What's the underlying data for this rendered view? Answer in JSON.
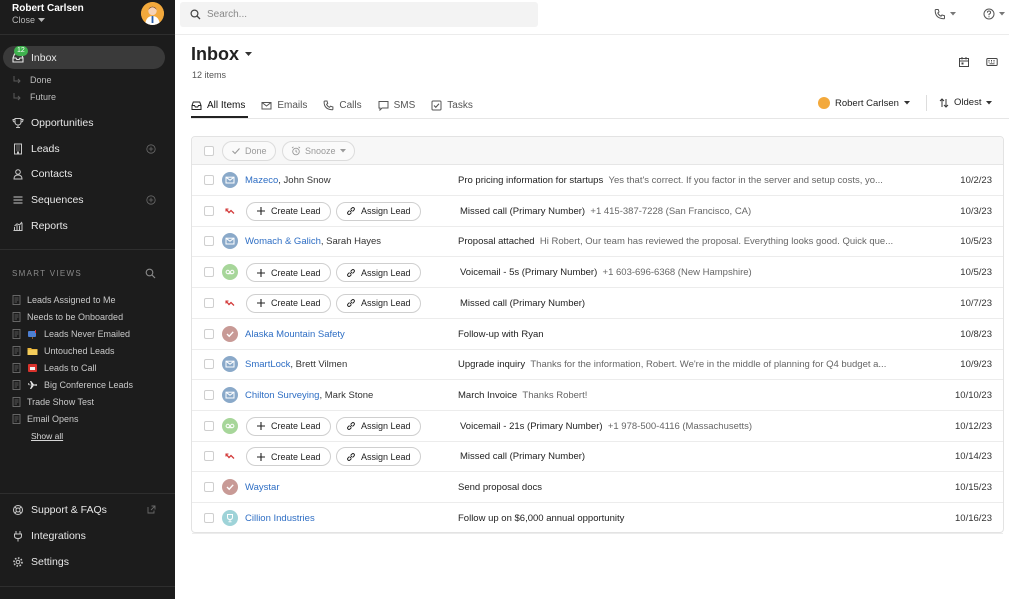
{
  "user": {
    "name": "Robert Carlsen",
    "org": "Close"
  },
  "nav": {
    "inbox_badge": "12",
    "items": [
      {
        "label": "Inbox",
        "icon": "inbox-icon"
      },
      {
        "label": "Done",
        "icon": "return-arrow-icon"
      },
      {
        "label": "Future",
        "icon": "return-arrow-icon"
      },
      {
        "label": "Opportunities",
        "icon": "trophy-icon"
      },
      {
        "label": "Leads",
        "icon": "building-icon"
      },
      {
        "label": "Contacts",
        "icon": "person-icon"
      },
      {
        "label": "Sequences",
        "icon": "list-icon"
      },
      {
        "label": "Reports",
        "icon": "chart-icon"
      }
    ]
  },
  "smart_views": {
    "header": "SMART VIEWS",
    "items": [
      {
        "label": "Leads Assigned to Me",
        "emoji": ""
      },
      {
        "label": "Needs to be Onboarded",
        "emoji": ""
      },
      {
        "label": "Leads Never Emailed",
        "emoji": "mailbox-emoji"
      },
      {
        "label": "Untouched Leads",
        "emoji": "folder-emoji"
      },
      {
        "label": "Leads to Call",
        "emoji": "phone-emoji"
      },
      {
        "label": "Big Conference Leads",
        "emoji": "airplane-emoji"
      },
      {
        "label": "Trade Show Test",
        "emoji": ""
      },
      {
        "label": "Email Opens",
        "emoji": ""
      }
    ],
    "show_all": "Show all"
  },
  "footer_nav": {
    "support": "Support & FAQs",
    "integrations": "Integrations",
    "settings": "Settings"
  },
  "search": {
    "placeholder": "Search..."
  },
  "page": {
    "title": "Inbox",
    "count": "12 items"
  },
  "tabs": [
    "All Items",
    "Emails",
    "Calls",
    "SMS",
    "Tasks"
  ],
  "filters": {
    "owner": "Robert Carlsen",
    "sort": "Oldest"
  },
  "toolbar": {
    "done": "Done",
    "snooze": "Snooze"
  },
  "actions": {
    "create_lead": "Create Lead",
    "assign_lead": "Assign Lead"
  },
  "colors": {
    "email": "#8aa9c9",
    "call_missed": "#d33b3b",
    "voicemail": "#a7d69a",
    "task": "#c89a96",
    "opportunity": "#9ed3d8",
    "link": "#2e6ec4"
  },
  "rows": [
    {
      "type": "email",
      "company": "Mazeco",
      "person": ", John Snow",
      "subject": "Pro pricing information for startups",
      "preview": "Yes that's correct. If you factor in the server and setup costs, yo...",
      "date": "10/2/23"
    },
    {
      "type": "missed",
      "company": "",
      "person": "",
      "subject": "Missed call (Primary Number)",
      "preview": "+1 415-387-7228 (San Francisco, CA)",
      "date": "10/3/23"
    },
    {
      "type": "email",
      "company": "Womach & Galich",
      "person": ", Sarah Hayes",
      "subject": "Proposal attached",
      "preview": "Hi Robert, Our team has reviewed the proposal. Everything looks good. Quick que...",
      "date": "10/5/23"
    },
    {
      "type": "voicemail",
      "company": "",
      "person": "",
      "subject": "Voicemail - 5s (Primary Number)",
      "preview": "+1 603-696-6368 (New Hampshire)",
      "date": "10/5/23"
    },
    {
      "type": "missed",
      "company": "",
      "person": "",
      "subject": "Missed call (Primary Number)",
      "preview": "",
      "date": "10/7/23"
    },
    {
      "type": "task",
      "company": "Alaska Mountain Safety",
      "person": "",
      "subject": "Follow-up with Ryan",
      "preview": "",
      "date": "10/8/23"
    },
    {
      "type": "email",
      "company": "SmartLock",
      "person": ", Brett Vilmen",
      "subject": "Upgrade inquiry",
      "preview": "Thanks for the information, Robert. We're in the middle of planning for Q4 budget a...",
      "date": "10/9/23"
    },
    {
      "type": "email",
      "company": "Chilton Surveying",
      "person": ", Mark Stone",
      "subject": "March Invoice",
      "preview": "Thanks Robert!",
      "date": "10/10/23"
    },
    {
      "type": "voicemail",
      "company": "",
      "person": "",
      "subject": "Voicemail - 21s (Primary Number)",
      "preview": "+1 978-500-4116 (Massachusetts)",
      "date": "10/12/23"
    },
    {
      "type": "missed",
      "company": "",
      "person": "",
      "subject": "Missed call (Primary Number)",
      "preview": "",
      "date": "10/14/23"
    },
    {
      "type": "task",
      "company": "Waystar",
      "person": "",
      "subject": "Send proposal docs",
      "preview": "",
      "date": "10/15/23"
    },
    {
      "type": "opportunity",
      "company": "Cillion Industries",
      "person": "",
      "subject": "Follow up on $6,000 annual opportunity",
      "preview": "",
      "date": "10/16/23"
    }
  ]
}
